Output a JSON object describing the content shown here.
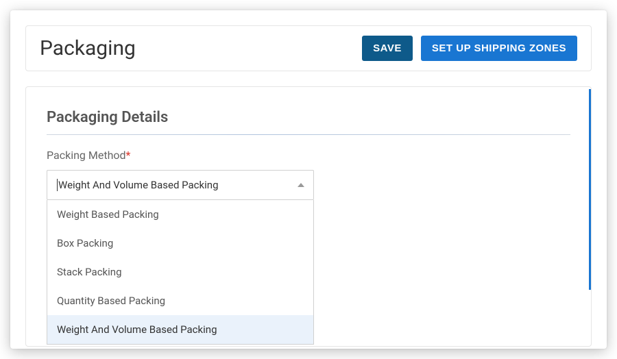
{
  "header": {
    "title": "Packaging",
    "save_label": "SAVE",
    "ship_zones_label": "SET UP SHIPPING ZONES"
  },
  "section": {
    "title": "Packaging Details",
    "field_label": "Packing Method",
    "required_mark": "*",
    "selected_value": "Weight And Volume Based Packing"
  },
  "dropdown": {
    "options": [
      {
        "label": "Weight Based Packing",
        "highlighted": false
      },
      {
        "label": "Box Packing",
        "highlighted": false
      },
      {
        "label": "Stack Packing",
        "highlighted": false
      },
      {
        "label": "Quantity Based Packing",
        "highlighted": false
      },
      {
        "label": "Weight And Volume Based Packing",
        "highlighted": true
      }
    ]
  }
}
